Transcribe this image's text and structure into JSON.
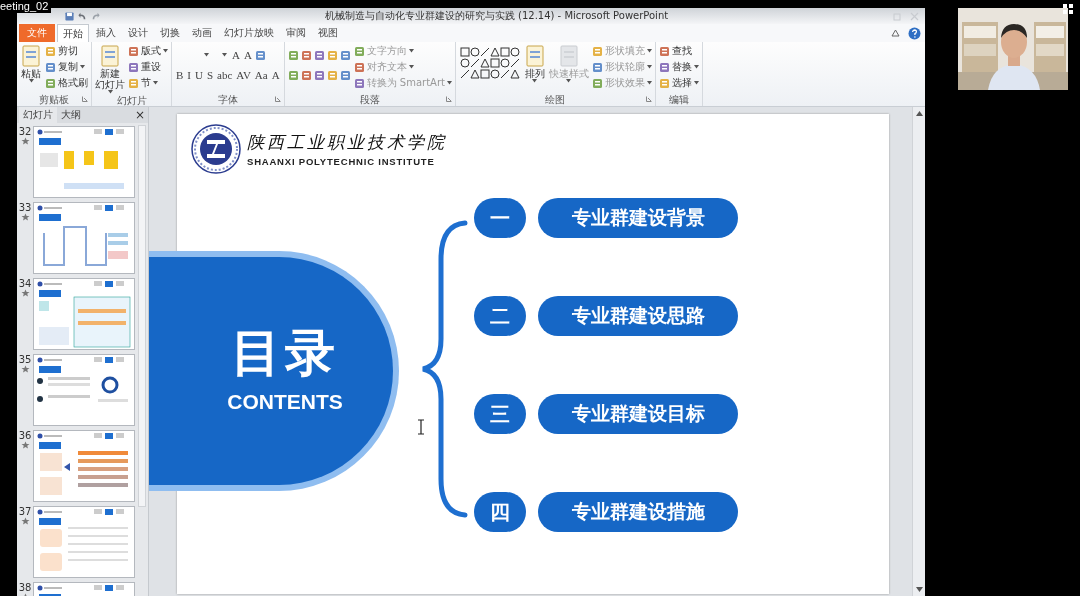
{
  "meeting_label": "eeting_02",
  "window": {
    "title": "机械制造与自动化专业群建设的研究与实践 (12.14) - Microsoft PowerPoint"
  },
  "ribbon_tabs": [
    {
      "label": "文件",
      "kind": "file",
      "selected": false
    },
    {
      "label": "开始",
      "kind": "tab",
      "selected": true
    },
    {
      "label": "插入",
      "kind": "tab",
      "selected": false
    },
    {
      "label": "设计",
      "kind": "tab",
      "selected": false
    },
    {
      "label": "切换",
      "kind": "tab",
      "selected": false
    },
    {
      "label": "动画",
      "kind": "tab",
      "selected": false
    },
    {
      "label": "幻灯片放映",
      "kind": "tab",
      "selected": false
    },
    {
      "label": "审阅",
      "kind": "tab",
      "selected": false
    },
    {
      "label": "视图",
      "kind": "tab",
      "selected": false
    }
  ],
  "ribbon_groups": [
    {
      "label": "剪贴板",
      "launcher": true,
      "columns": [
        {
          "kind": "large",
          "items": [
            {
              "lines": [
                "粘贴"
              ],
              "menu": true,
              "disabled": false
            }
          ]
        },
        {
          "kind": "stack",
          "items": [
            {
              "label": "剪切",
              "menu": false,
              "disabled": false
            },
            {
              "label": "复制",
              "menu": true,
              "disabled": false
            },
            {
              "label": "格式刷",
              "menu": false,
              "disabled": false
            }
          ]
        }
      ]
    },
    {
      "label": "幻灯片",
      "launcher": false,
      "columns": [
        {
          "kind": "large",
          "items": [
            {
              "lines": [
                "新建",
                "幻灯片"
              ],
              "menu": true,
              "disabled": false
            }
          ]
        },
        {
          "kind": "stack",
          "items": [
            {
              "label": "版式",
              "menu": true,
              "disabled": false
            },
            {
              "label": "重设",
              "menu": false,
              "disabled": false
            },
            {
              "label": "节",
              "menu": true,
              "disabled": false
            }
          ]
        }
      ]
    },
    {
      "label": "字体",
      "launcher": true,
      "columns": [
        {
          "kind": "toolbars",
          "toolbars": [
            {
              "items": [
                {
                  "kind": "fontbox"
                },
                {
                  "kind": "sizebox"
                },
                {
                  "kind": "glyph",
                  "label": "A"
                },
                {
                  "kind": "glyph",
                  "label": "A"
                },
                {
                  "kind": "icon"
                }
              ]
            },
            {
              "items": [
                {
                  "kind": "glyph",
                  "label": "B"
                },
                {
                  "kind": "glyph",
                  "label": "I"
                },
                {
                  "kind": "glyph",
                  "label": "U"
                },
                {
                  "kind": "glyph",
                  "label": "S"
                },
                {
                  "kind": "glyph",
                  "label": "abc"
                },
                {
                  "kind": "glyph",
                  "label": "AV"
                },
                {
                  "kind": "glyph",
                  "label": "Aa"
                },
                {
                  "kind": "glyph",
                  "label": "A"
                }
              ]
            }
          ]
        }
      ]
    },
    {
      "label": "段落",
      "launcher": true,
      "columns": [
        {
          "kind": "toolbars",
          "toolbars": [
            {
              "items": [
                {
                  "kind": "icon"
                },
                {
                  "kind": "icon"
                },
                {
                  "kind": "icon"
                },
                {
                  "kind": "icon"
                },
                {
                  "kind": "icon"
                }
              ]
            },
            {
              "items": [
                {
                  "kind": "icon"
                },
                {
                  "kind": "icon"
                },
                {
                  "kind": "icon"
                },
                {
                  "kind": "icon"
                },
                {
                  "kind": "icon"
                }
              ]
            }
          ]
        },
        {
          "kind": "stack",
          "items": [
            {
              "label": "文字方向",
              "menu": true,
              "disabled": true
            },
            {
              "label": "对齐文本",
              "menu": true,
              "disabled": true
            },
            {
              "label": "转换为 SmartArt",
              "menu": true,
              "disabled": true
            }
          ]
        }
      ]
    },
    {
      "label": "绘图",
      "launcher": true,
      "columns": [
        {
          "kind": "gallery"
        },
        {
          "kind": "large",
          "items": [
            {
              "lines": [
                "排列"
              ],
              "menu": true,
              "disabled": false
            }
          ]
        },
        {
          "kind": "large",
          "items": [
            {
              "lines": [
                "快速样式"
              ],
              "menu": true,
              "disabled": true
            }
          ]
        },
        {
          "kind": "stack",
          "items": [
            {
              "label": "形状填充",
              "menu": true,
              "disabled": true
            },
            {
              "label": "形状轮廓",
              "menu": true,
              "disabled": true
            },
            {
              "label": "形状效果",
              "menu": true,
              "disabled": true
            }
          ]
        }
      ]
    },
    {
      "label": "编辑",
      "launcher": false,
      "columns": [
        {
          "kind": "stack",
          "items": [
            {
              "label": "查找",
              "menu": false,
              "disabled": false
            },
            {
              "label": "替换",
              "menu": true,
              "disabled": false
            },
            {
              "label": "选择",
              "menu": true,
              "disabled": false
            }
          ]
        }
      ]
    }
  ],
  "pane_tabs": [
    {
      "label": "幻灯片",
      "selected": true
    },
    {
      "label": "大纲",
      "selected": false
    }
  ],
  "pane_close": "×",
  "slides": [
    {
      "number": "32"
    },
    {
      "number": "33"
    },
    {
      "number": "34"
    },
    {
      "number": "35"
    },
    {
      "number": "36"
    },
    {
      "number": "37"
    },
    {
      "number": "38"
    }
  ],
  "slide": {
    "school_cn": "陕西工业职业技术学院",
    "school_en": "SHAANXI POLYTECHNIC INSTITUTE",
    "heading": "目录",
    "subheading": "CONTENTS",
    "items": [
      {
        "number": "一",
        "title": "专业群建设背景"
      },
      {
        "number": "二",
        "title": "专业群建设思路"
      },
      {
        "number": "三",
        "title": "专业群建设目标"
      },
      {
        "number": "四",
        "title": "专业群建设措施"
      }
    ]
  }
}
